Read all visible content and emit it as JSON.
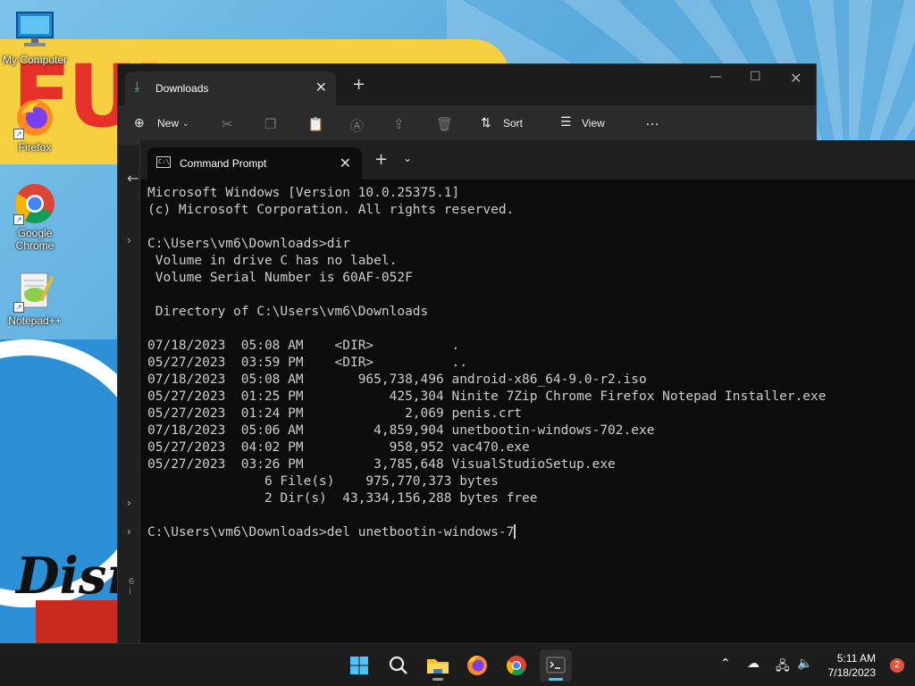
{
  "desktop": {
    "icons": [
      {
        "label": "My Computer",
        "icon": "monitor-icon"
      },
      {
        "label": "Firefox",
        "icon": "firefox-icon"
      },
      {
        "label": "Google Chrome",
        "icon": "chrome-icon"
      },
      {
        "label": "Notepad++",
        "icon": "notepadpp-icon"
      }
    ]
  },
  "explorer": {
    "tab_title": "Downloads",
    "toolbar": {
      "new_label": "New",
      "sort_label": "Sort",
      "view_label": "View",
      "more_label": "…"
    },
    "status_fragment": "6 i"
  },
  "terminal": {
    "tab_title": "Command Prompt",
    "lines": [
      "Microsoft Windows [Version 10.0.25375.1]",
      "(c) Microsoft Corporation. All rights reserved.",
      "",
      "C:\\Users\\vm6\\Downloads>dir",
      " Volume in drive C has no label.",
      " Volume Serial Number is 60AF-052F",
      "",
      " Directory of C:\\Users\\vm6\\Downloads",
      "",
      "07/18/2023  05:08 AM    <DIR>          .",
      "05/27/2023  03:59 PM    <DIR>          ..",
      "07/18/2023  05:08 AM       965,738,496 android-x86_64-9.0-r2.iso",
      "05/27/2023  01:25 PM           425,304 Ninite 7Zip Chrome Firefox Notepad Installer.exe",
      "05/27/2023  01:24 PM             2,069 penis.crt",
      "07/18/2023  05:06 AM         4,859,904 unetbootin-windows-702.exe",
      "05/27/2023  04:02 PM           958,952 vac470.exe",
      "05/27/2023  03:26 PM         3,785,648 VisualStudioSetup.exe",
      "               6 File(s)    975,770,373 bytes",
      "               2 Dir(s)  43,334,156,288 bytes free",
      ""
    ],
    "prompt": "C:\\Users\\vm6\\Downloads>",
    "current_input": "del unetbootin-windows-7"
  },
  "taskbar": {
    "apps": [
      {
        "name": "start-button",
        "icon": "windows-icon"
      },
      {
        "name": "search-button",
        "icon": "search-icon"
      },
      {
        "name": "file-explorer",
        "icon": "folder-icon"
      },
      {
        "name": "firefox",
        "icon": "firefox-icon"
      },
      {
        "name": "chrome",
        "icon": "chrome-icon"
      },
      {
        "name": "terminal",
        "icon": "terminal-icon"
      }
    ],
    "time": "5:11 AM",
    "date": "7/18/2023",
    "notification_count": "2"
  },
  "colors": {
    "accent": "#4cc2ff",
    "terminal_bg": "#0c0c0c",
    "terminal_fg": "#cccccc",
    "taskbar_bg": "#1c1c1c"
  }
}
